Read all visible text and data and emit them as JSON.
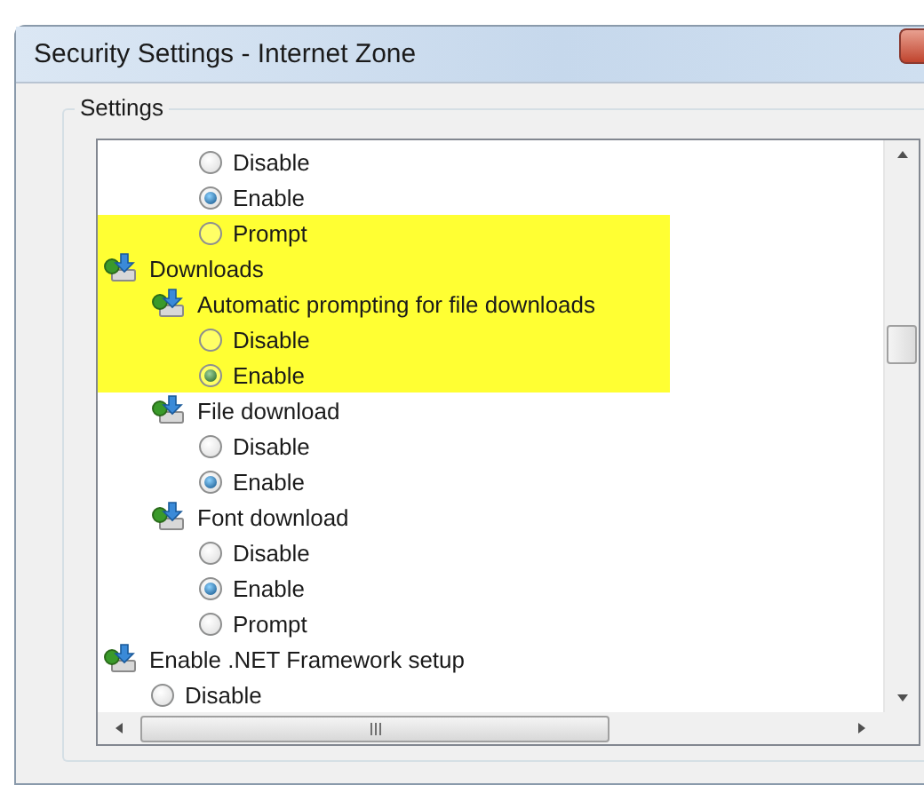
{
  "window": {
    "title": "Security Settings - Internet Zone"
  },
  "group": {
    "label": "Settings"
  },
  "list": {
    "continued_options": [
      {
        "kind": "option",
        "label": "Disable",
        "selected": false,
        "highlighted": false
      },
      {
        "kind": "option",
        "label": "Enable",
        "selected": true,
        "highlighted": false
      },
      {
        "kind": "option",
        "label": "Prompt",
        "selected": false,
        "highlighted": true
      }
    ],
    "items": [
      {
        "kind": "setting",
        "label": "Downloads",
        "highlighted": true,
        "children": [
          {
            "kind": "setting",
            "label": "Automatic prompting for file downloads",
            "highlighted": true,
            "children": [
              {
                "kind": "option",
                "label": "Disable",
                "selected": false,
                "highlighted": true
              },
              {
                "kind": "option",
                "label": "Enable",
                "selected": true,
                "highlighted": true
              }
            ]
          },
          {
            "kind": "setting",
            "label": "File download",
            "highlighted": false,
            "children": [
              {
                "kind": "option",
                "label": "Disable",
                "selected": false,
                "highlighted": false
              },
              {
                "kind": "option",
                "label": "Enable",
                "selected": true,
                "highlighted": false
              }
            ]
          },
          {
            "kind": "setting",
            "label": "Font download",
            "highlighted": false,
            "children": [
              {
                "kind": "option",
                "label": "Disable",
                "selected": false,
                "highlighted": false
              },
              {
                "kind": "option",
                "label": "Enable",
                "selected": true,
                "highlighted": false
              },
              {
                "kind": "option",
                "label": "Prompt",
                "selected": false,
                "highlighted": false
              }
            ]
          }
        ]
      },
      {
        "kind": "setting",
        "label": "Enable .NET Framework setup",
        "highlighted": false,
        "children": [
          {
            "kind": "option",
            "label": "Disable",
            "selected": false,
            "highlighted": false
          }
        ]
      }
    ]
  }
}
